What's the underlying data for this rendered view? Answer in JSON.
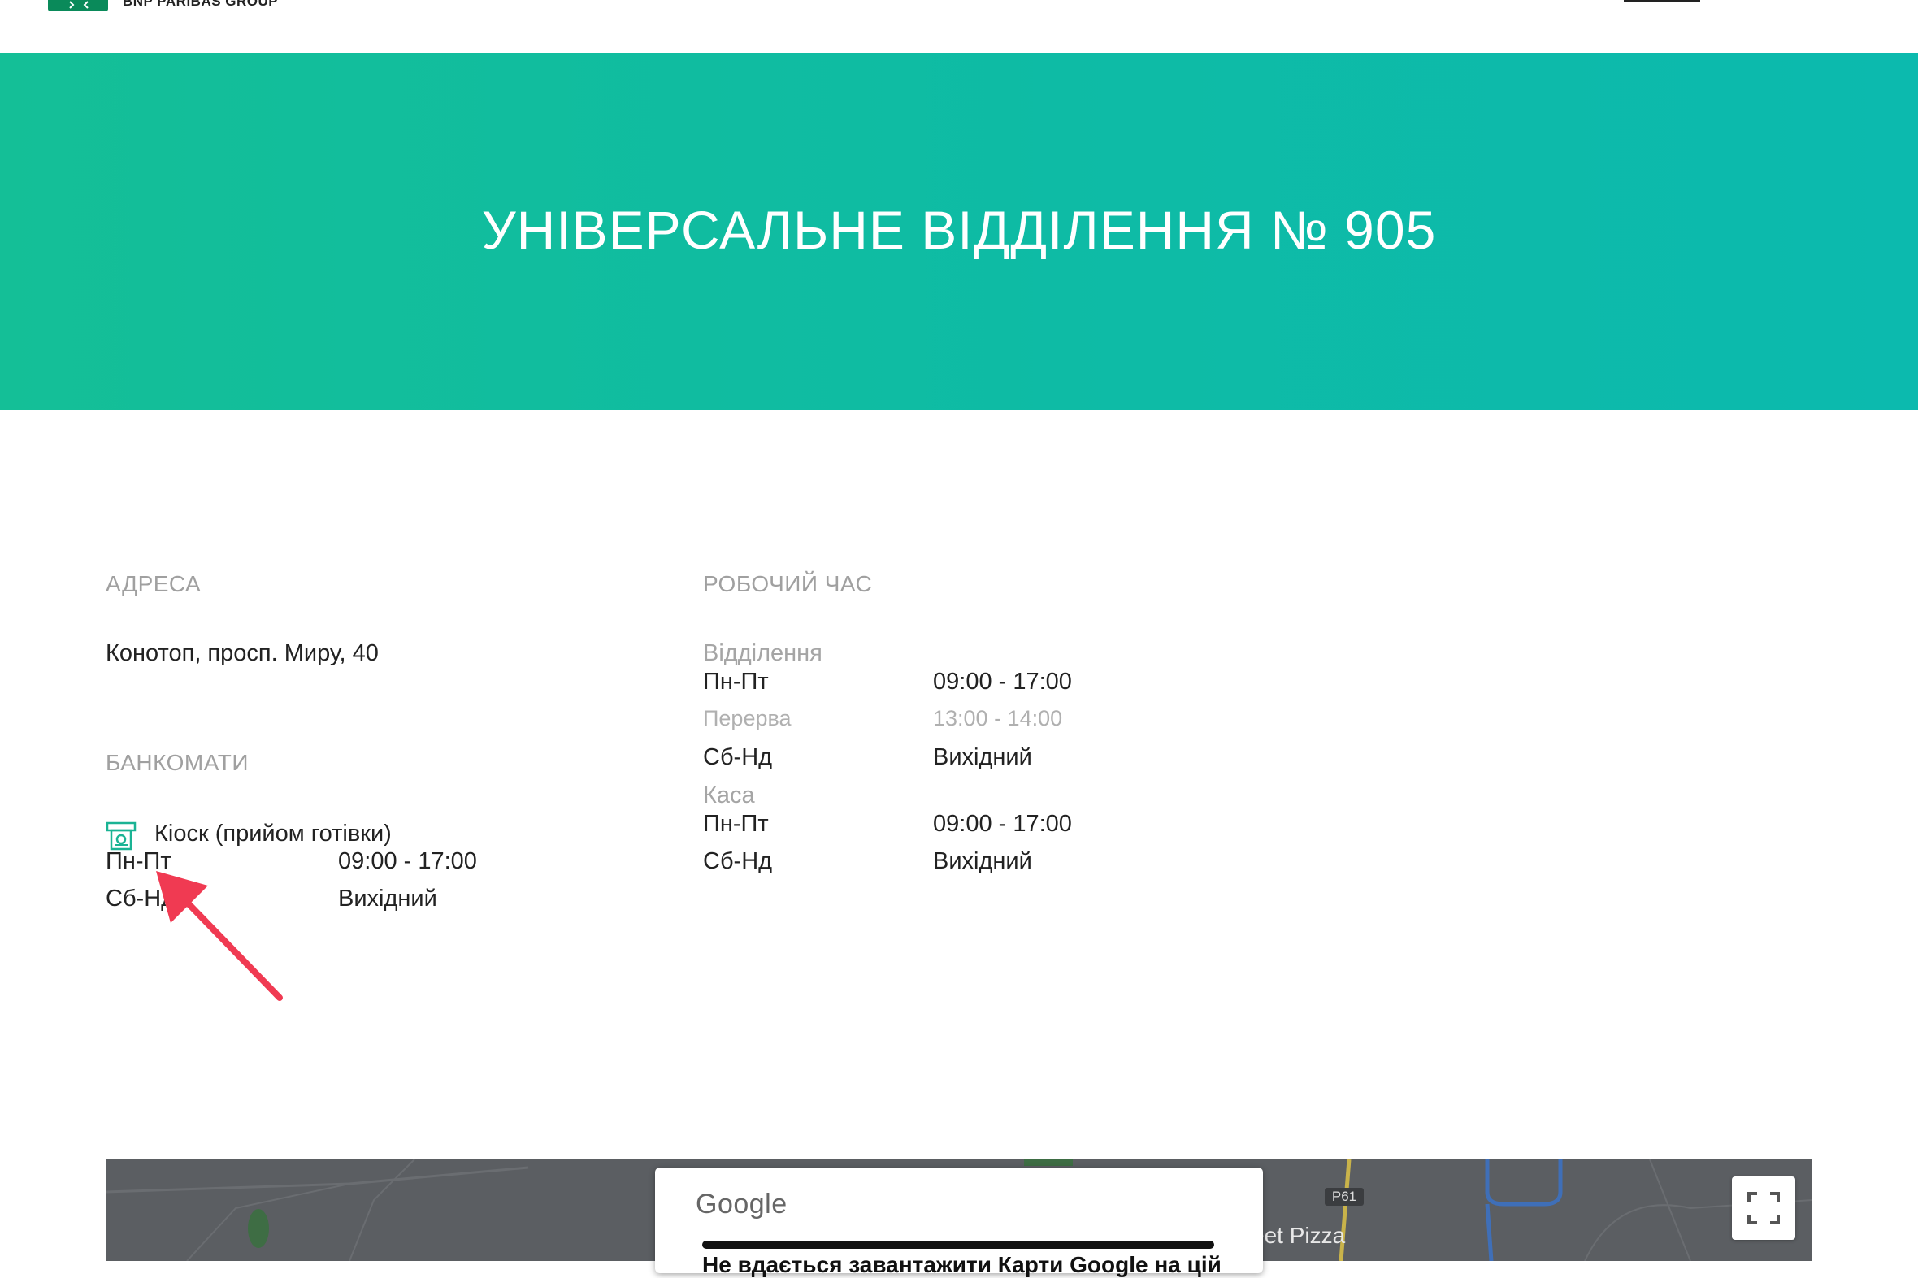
{
  "header": {
    "brand_text": "BNP PARIBAS GROUP"
  },
  "hero": {
    "title": "УНІВЕРСАЛЬНЕ ВІДДІЛЕННЯ № 905"
  },
  "address": {
    "label": "АДРЕСА",
    "value": "Конотоп, просп. Миру, 40"
  },
  "atms": {
    "label": "БАНКОМАТИ",
    "item": {
      "icon": "cash-kiosk-icon",
      "title": "Кіоск (прийом готівки)",
      "schedule": [
        {
          "days": "Пн-Пт",
          "hours": "09:00 - 17:00"
        },
        {
          "days": "Сб-Нд",
          "hours": "Вихідний"
        }
      ]
    }
  },
  "working_hours": {
    "label": "РОБОЧИЙ ЧАС",
    "branch": {
      "title": "Відділення",
      "weekdays": {
        "days": "Пн-Пт",
        "hours": "09:00 - 17:00"
      },
      "break": {
        "days": "Перерва",
        "hours": "13:00 - 14:00"
      },
      "weekend": {
        "days": "Сб-Нд",
        "hours": "Вихідний"
      }
    },
    "cashdesk": {
      "title": "Каса",
      "weekdays": {
        "days": "Пн-Пт",
        "hours": "09:00 - 17:00"
      },
      "weekend": {
        "days": "Сб-Нд",
        "hours": "Вихідний"
      }
    }
  },
  "map": {
    "dialog_brand": "Google",
    "dialog_text": "Не вдається завантажити Карти Google на цій",
    "road_badge": "P61",
    "place_label": "eet Pizza",
    "fullscreen_icon": "fullscreen-icon"
  },
  "colors": {
    "hero_start": "#14bf97",
    "hero_end": "#0cbaae",
    "accent": "#1ab394",
    "arrow": "#f03a52"
  }
}
